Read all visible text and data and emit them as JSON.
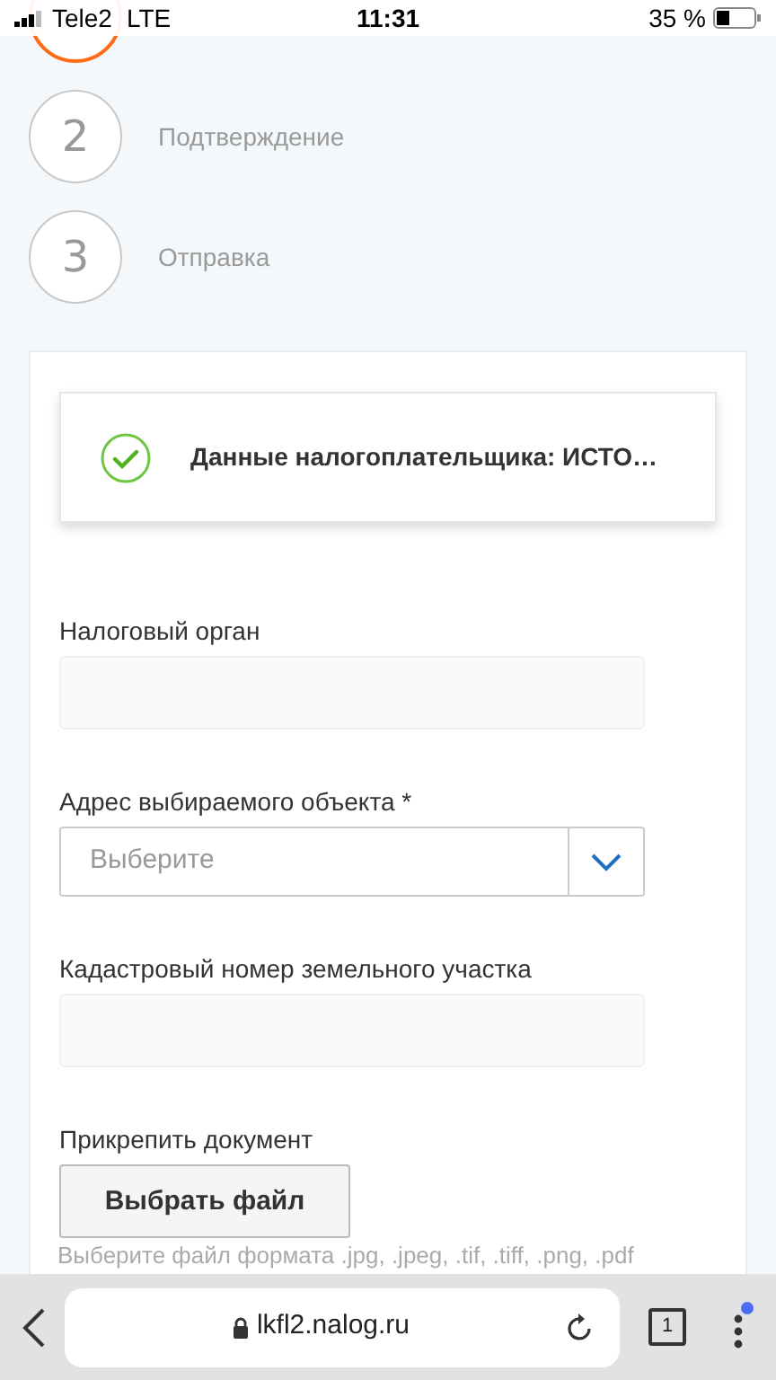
{
  "status_bar": {
    "carrier": "Tele2",
    "network": "LTE",
    "time": "11:31",
    "battery": "35 %"
  },
  "steps": [
    {
      "active": true
    },
    {
      "number": "2",
      "label": "Подтверждение",
      "active": false
    },
    {
      "number": "3",
      "label": "Отправка",
      "active": false
    }
  ],
  "summary": {
    "title": "Данные налогоплательщика: ИСТО…",
    "done": true
  },
  "fields": [
    {
      "kind": "text",
      "label": "Налоговый орган"
    },
    {
      "kind": "select",
      "label": "Адрес выбираемого объекта *",
      "placeholder": "Выберите"
    },
    {
      "kind": "text",
      "label": "Кадастровый номер земельного участка"
    },
    {
      "kind": "file",
      "label": "Прикрепить документ",
      "button": "Выбрать файл",
      "hint": "Выберите файл формата .jpg, .jpeg, .tif, .tiff, .png, .pdf"
    }
  ],
  "browser": {
    "url": "lkfl2.nalog.ru",
    "tabs": "1",
    "notification": true
  }
}
